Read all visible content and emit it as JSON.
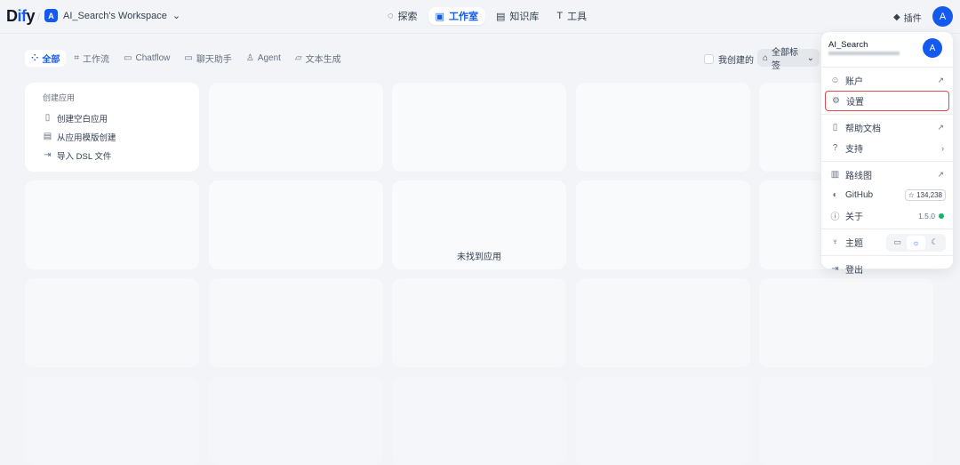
{
  "header": {
    "logo_a": "D",
    "logo_b": "if",
    "logo_c": "y",
    "workspace_initial": "A",
    "workspace": "AI_Search's Workspace",
    "nav": [
      "探索",
      "工作室",
      "知识库",
      "工具"
    ],
    "plugins": "插件",
    "avatar": "A"
  },
  "filters": {
    "tabs": [
      "全部",
      "工作流",
      "Chatflow",
      "聊天助手",
      "Agent",
      "文本生成"
    ],
    "mine": "我创建的",
    "tags": "全部标签"
  },
  "create": {
    "title": "创建应用",
    "items": [
      "创建空白应用",
      "从应用模版创建",
      "导入 DSL 文件"
    ]
  },
  "empty": "未找到应用",
  "menu": {
    "name": "AI_Search",
    "avatar": "A",
    "account": "账户",
    "settings": "设置",
    "docs": "帮助文档",
    "support": "支持",
    "roadmap": "路线图",
    "github": "GitHub",
    "stars": "134,238",
    "about": "关于",
    "version": "1.5.0",
    "theme": "主题",
    "logout": "登出"
  }
}
